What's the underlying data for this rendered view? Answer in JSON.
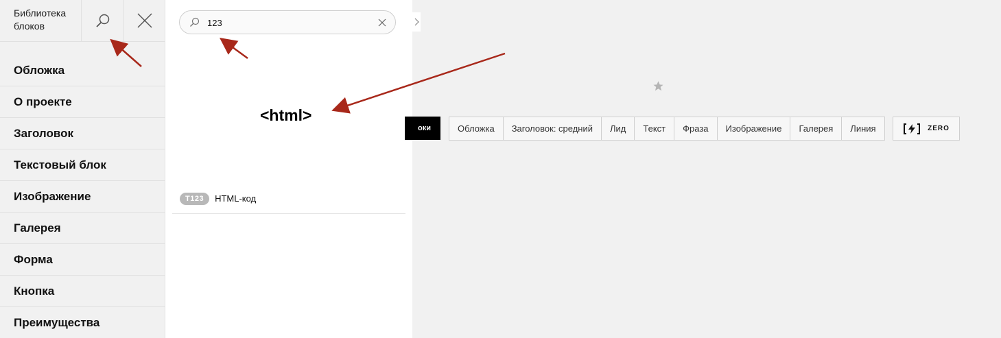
{
  "sidebar": {
    "title": "Библиотека блоков",
    "search_icon": "search-icon",
    "close_icon": "close-icon",
    "items": [
      {
        "label": "Обложка"
      },
      {
        "label": "О проекте"
      },
      {
        "label": "Заголовок"
      },
      {
        "label": "Текстовый блок"
      },
      {
        "label": "Изображение"
      },
      {
        "label": "Галерея"
      },
      {
        "label": "Форма"
      },
      {
        "label": "Кнопка"
      },
      {
        "label": "Преимущества"
      }
    ]
  },
  "search": {
    "value": "123",
    "placeholder": ""
  },
  "result": {
    "preview_text": "<html>",
    "badge": "T123",
    "name": "HTML-код"
  },
  "editor": {
    "all_blocks_label": "оки",
    "quick_blocks": [
      {
        "label": "Обложка"
      },
      {
        "label": "Заголовок: средний"
      },
      {
        "label": "Лид"
      },
      {
        "label": "Текст"
      },
      {
        "label": "Фраза"
      },
      {
        "label": "Изображение"
      },
      {
        "label": "Галерея"
      },
      {
        "label": "Линия"
      }
    ],
    "zero_label": "ZERO"
  },
  "colors": {
    "arrow": "#a8281a",
    "background": "#f1f1f1",
    "badge": "#b8b8b8"
  }
}
